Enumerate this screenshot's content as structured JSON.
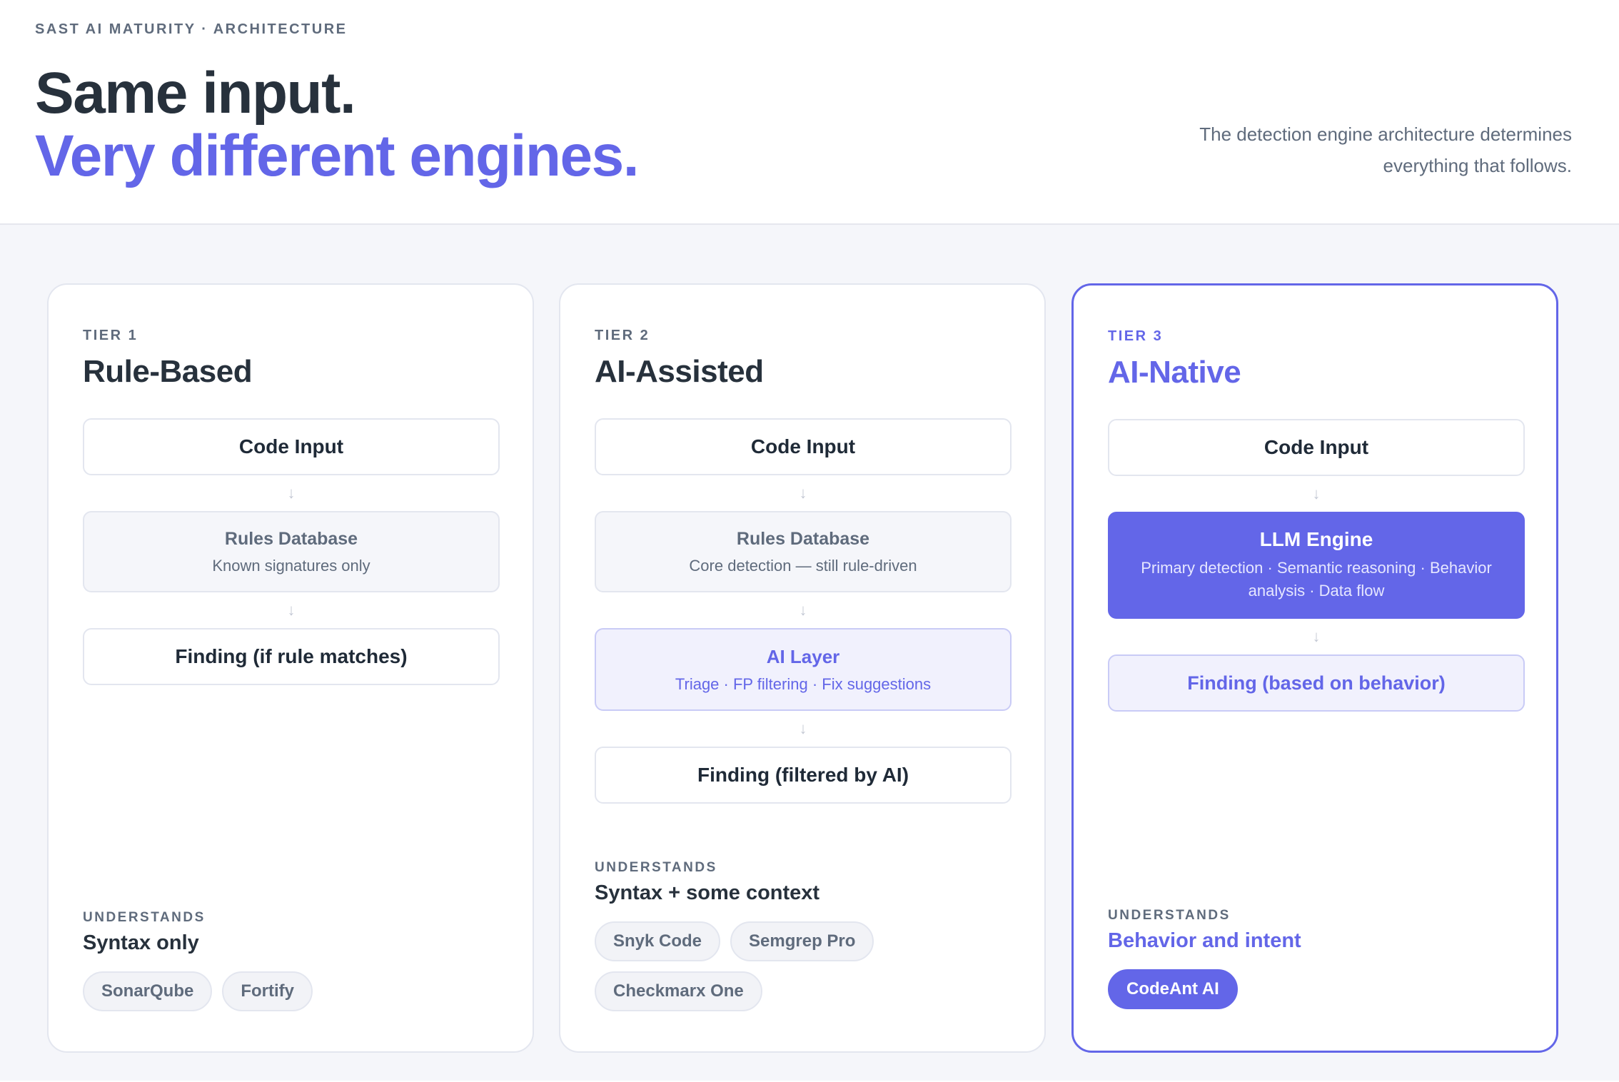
{
  "header": {
    "eyebrow": "SAST AI MATURITY · ARCHITECTURE",
    "title_line1": "Same input.",
    "title_line2": "Very different engines.",
    "subtitle": "The detection engine architecture determines everything that follows."
  },
  "colors": {
    "accent": "#6366e8",
    "dark_text": "#27313c",
    "muted_text": "#5f6b7c",
    "stage_bg": "#f5f6fa"
  },
  "tiers": [
    {
      "tier": "TIER 1",
      "name": "Rule-Based",
      "flow": [
        {
          "title": "Code Input"
        },
        {
          "title": "Rules Database",
          "subtitle": "Known signatures only"
        },
        {
          "title": "Finding (if rule matches)"
        }
      ],
      "understands_label": "UNDERSTANDS",
      "understands": "Syntax only",
      "tools": [
        "SonarQube",
        "Fortify"
      ]
    },
    {
      "tier": "TIER 2",
      "name": "AI-Assisted",
      "flow": [
        {
          "title": "Code Input"
        },
        {
          "title": "Rules Database",
          "subtitle": "Core detection — still rule-driven"
        },
        {
          "title": "AI Layer",
          "subtitle": "Triage · FP filtering · Fix suggestions"
        },
        {
          "title": "Finding (filtered by AI)"
        }
      ],
      "understands_label": "UNDERSTANDS",
      "understands": "Syntax + some context",
      "tools": [
        "Snyk Code",
        "Semgrep Pro",
        "Checkmarx One"
      ]
    },
    {
      "tier": "TIER 3",
      "name": "AI-Native",
      "flow": [
        {
          "title": "Code Input"
        },
        {
          "title": "LLM Engine",
          "subtitle": "Primary detection · Semantic reasoning · Behavior analysis · Data flow"
        },
        {
          "title": "Finding (based on behavior)"
        }
      ],
      "understands_label": "UNDERSTANDS",
      "understands": "Behavior and intent",
      "tools": [
        "CodeAnt AI"
      ]
    }
  ]
}
